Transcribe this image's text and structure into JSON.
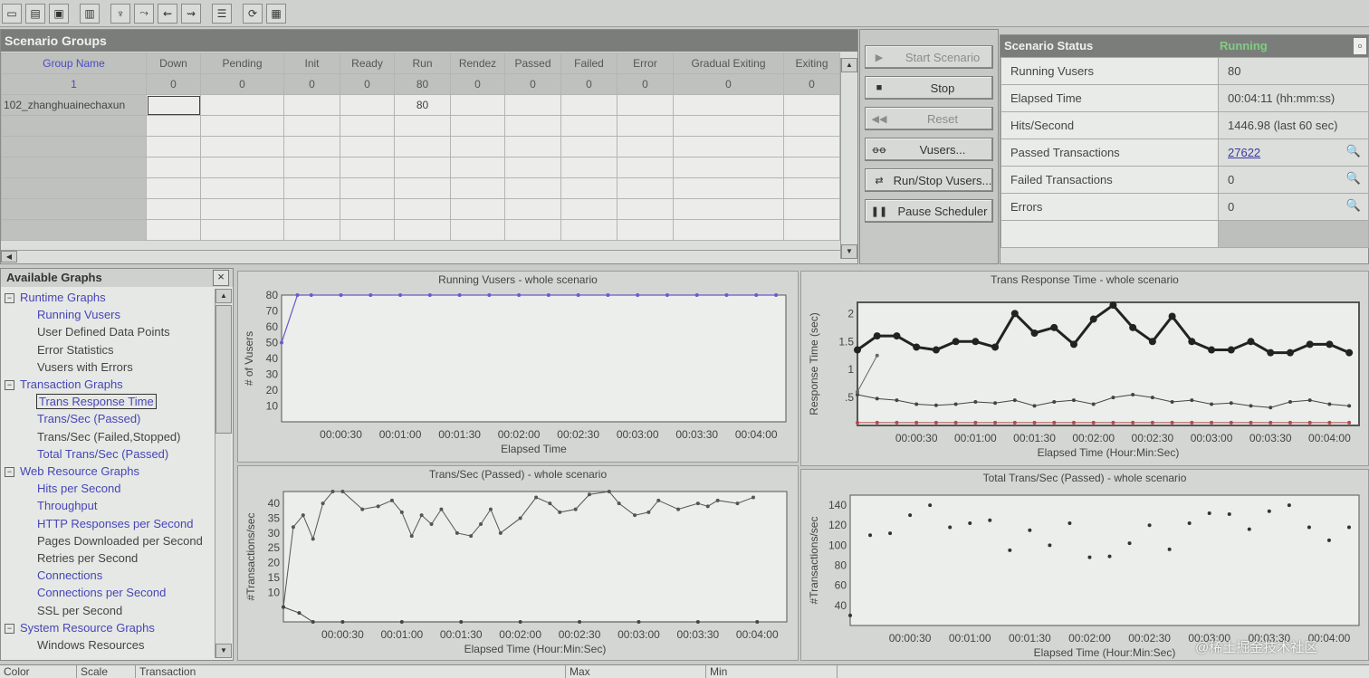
{
  "toolbar": {
    "icons": [
      "open-icon",
      "save-icon",
      "floppy-icon",
      "clipboard-icon",
      "host-icon",
      "step-icon",
      "step-back-icon",
      "step-up-icon",
      "list-icon",
      "refresh-icon",
      "grid-icon"
    ]
  },
  "scenario_groups": {
    "title": "Scenario Groups",
    "columns": [
      {
        "label": "Group Name",
        "count": "1"
      },
      {
        "label": "Down",
        "count": "0"
      },
      {
        "label": "Pending",
        "count": "0"
      },
      {
        "label": "Init",
        "count": "0"
      },
      {
        "label": "Ready",
        "count": "0"
      },
      {
        "label": "Run",
        "count": "80"
      },
      {
        "label": "Rendez",
        "count": "0"
      },
      {
        "label": "Passed",
        "count": "0"
      },
      {
        "label": "Failed",
        "count": "0"
      },
      {
        "label": "Error",
        "count": "0"
      },
      {
        "label": "Gradual Exiting",
        "count": "0"
      },
      {
        "label": "Exiting",
        "count": "0"
      }
    ],
    "rows": [
      {
        "group_name": "102_zhanghuainechaxun",
        "run": "80"
      }
    ]
  },
  "buttons": {
    "start": "Start Scenario",
    "stop": "Stop",
    "reset": "Reset",
    "vusers": "Vusers...",
    "run_stop": "Run/Stop Vusers...",
    "pause": "Pause Scheduler"
  },
  "scenario_status": {
    "title": "Scenario Status",
    "state": "Running",
    "rows": [
      {
        "label": "Running Vusers",
        "value": "80"
      },
      {
        "label": "Elapsed Time",
        "value": "00:04:11 (hh:mm:ss)"
      },
      {
        "label": "Hits/Second",
        "value": "1446.98 (last 60 sec)"
      },
      {
        "label": "Passed Transactions",
        "value": "27622"
      },
      {
        "label": "Failed Transactions",
        "value": "0"
      },
      {
        "label": "Errors",
        "value": "0"
      }
    ]
  },
  "available_graphs": {
    "title": "Available Graphs",
    "close": "×",
    "tree": [
      {
        "type": "cat",
        "label": "Runtime Graphs"
      },
      {
        "type": "link",
        "label": "Running Vusers"
      },
      {
        "type": "plain",
        "label": "User Defined Data Points"
      },
      {
        "type": "plain",
        "label": "Error Statistics"
      },
      {
        "type": "plain",
        "label": "Vusers with Errors"
      },
      {
        "type": "cat",
        "label": "Transaction Graphs"
      },
      {
        "type": "link",
        "label": "Trans Response Time"
      },
      {
        "type": "link",
        "label": "Trans/Sec (Passed)"
      },
      {
        "type": "plain",
        "label": "Trans/Sec (Failed,Stopped)"
      },
      {
        "type": "link",
        "label": "Total Trans/Sec (Passed)"
      },
      {
        "type": "cat",
        "label": "Web Resource Graphs"
      },
      {
        "type": "link",
        "label": "Hits per Second"
      },
      {
        "type": "link",
        "label": "Throughput"
      },
      {
        "type": "link",
        "label": "HTTP Responses per Second"
      },
      {
        "type": "plain",
        "label": "Pages Downloaded per Second"
      },
      {
        "type": "plain",
        "label": "Retries per Second"
      },
      {
        "type": "link",
        "label": "Connections"
      },
      {
        "type": "link",
        "label": "Connections per Second"
      },
      {
        "type": "plain",
        "label": "SSL per Second"
      },
      {
        "type": "cat",
        "label": "System Resource Graphs"
      },
      {
        "type": "plain",
        "label": "Windows Resources"
      }
    ]
  },
  "graphs": {
    "running_vusers": {
      "title": "Running Vusers - whole scenario",
      "ylabel": "# of Vusers",
      "xlabel": "Elapsed Time",
      "yticks": [
        "80",
        "70",
        "60",
        "50",
        "40",
        "30",
        "20",
        "10"
      ],
      "xticks": [
        "00:00:30",
        "00:01:00",
        "00:01:30",
        "00:02:00",
        "00:02:30",
        "00:03:00",
        "00:03:30",
        "00:04:00"
      ]
    },
    "trans_response_time": {
      "title": "Trans Response Time - whole scenario",
      "ylabel": "Response Time (sec)",
      "xlabel": "Elapsed Time (Hour:Min:Sec)",
      "yticks": [
        "2",
        "1.5",
        "1",
        ".5"
      ],
      "xticks": [
        "00:00:30",
        "00:01:00",
        "00:01:30",
        "00:02:00",
        "00:02:30",
        "00:03:00",
        "00:03:30",
        "00:04:00"
      ]
    },
    "trans_sec_passed": {
      "title": "Trans/Sec (Passed) - whole scenario",
      "ylabel": "#Transactions/sec",
      "xlabel": "Elapsed Time (Hour:Min:Sec)",
      "yticks": [
        "40",
        "35",
        "30",
        "25",
        "20",
        "15",
        "10"
      ],
      "xticks": [
        "00:00:30",
        "00:01:00",
        "00:01:30",
        "00:02:00",
        "00:02:30",
        "00:03:00",
        "00:03:30",
        "00:04:00"
      ]
    },
    "total_trans_sec": {
      "title": "Total Trans/Sec (Passed) - whole scenario",
      "ylabel": "#Transactions/sec",
      "xlabel": "Elapsed Time (Hour:Min:Sec)",
      "yticks": [
        "140",
        "120",
        "100",
        "80",
        "60",
        "40"
      ],
      "xticks": [
        "00:00:30",
        "00:01:00",
        "00:01:30",
        "00:02:00",
        "00:02:30",
        "00:03:00",
        "00:03:30",
        "00:04:00"
      ]
    }
  },
  "chart_data": [
    {
      "type": "line",
      "title": "Running Vusers - whole scenario",
      "xlabel": "Elapsed Time",
      "ylabel": "# of Vusers",
      "ylim": [
        0,
        80
      ],
      "xlim": [
        0,
        255
      ],
      "series": [
        {
          "x": [
            0,
            8,
            15,
            30,
            45,
            60,
            75,
            90,
            105,
            120,
            135,
            150,
            165,
            180,
            195,
            210,
            225,
            240,
            250
          ],
          "y": [
            50,
            80,
            80,
            80,
            80,
            80,
            80,
            80,
            80,
            80,
            80,
            80,
            80,
            80,
            80,
            80,
            80,
            80,
            80
          ],
          "color": "#6a5acd"
        }
      ]
    },
    {
      "type": "line",
      "title": "Trans Response Time - whole scenario",
      "xlabel": "Elapsed Time (Hour:Min:Sec)",
      "ylabel": "Response Time (sec)",
      "ylim": [
        0,
        2.2
      ],
      "xlim": [
        0,
        255
      ],
      "series": [
        {
          "x": [
            0,
            10,
            20,
            30,
            40,
            50,
            60,
            70,
            80,
            90,
            100,
            110,
            120,
            130,
            140,
            150,
            160,
            170,
            180,
            190,
            200,
            210,
            220,
            230,
            240,
            250
          ],
          "y": [
            1.35,
            1.6,
            1.6,
            1.4,
            1.35,
            1.5,
            1.5,
            1.4,
            2.0,
            1.65,
            1.75,
            1.45,
            1.9,
            2.15,
            1.75,
            1.5,
            1.95,
            1.5,
            1.35,
            1.35,
            1.5,
            1.3,
            1.3,
            1.45,
            1.45,
            1.3
          ],
          "color": "#222",
          "width": 3
        },
        {
          "x": [
            0,
            10,
            20,
            30,
            40,
            50,
            60,
            70,
            80,
            90,
            100,
            110,
            120,
            130,
            140,
            150,
            160,
            170,
            180,
            190,
            200,
            210,
            220,
            230,
            240,
            250
          ],
          "y": [
            0.55,
            0.48,
            0.45,
            0.38,
            0.36,
            0.38,
            0.42,
            0.4,
            0.45,
            0.35,
            0.42,
            0.45,
            0.38,
            0.5,
            0.55,
            0.5,
            0.42,
            0.45,
            0.38,
            0.4,
            0.35,
            0.32,
            0.42,
            0.45,
            0.38,
            0.35
          ],
          "color": "#444",
          "width": 1
        },
        {
          "x": [
            0,
            10,
            20,
            30,
            40,
            50,
            60,
            70,
            80,
            90,
            100,
            110,
            120,
            130,
            140,
            150,
            160,
            170,
            180,
            190,
            200,
            210,
            220,
            230,
            240,
            250
          ],
          "y": [
            0.05,
            0.05,
            0.05,
            0.05,
            0.05,
            0.05,
            0.05,
            0.05,
            0.05,
            0.05,
            0.05,
            0.05,
            0.05,
            0.05,
            0.05,
            0.05,
            0.05,
            0.05,
            0.05,
            0.05,
            0.05,
            0.05,
            0.05,
            0.05,
            0.05,
            0.05
          ],
          "color": "#b04a4a",
          "width": 1
        },
        {
          "x": [
            0,
            10
          ],
          "y": [
            0.6,
            1.25
          ],
          "color": "#666",
          "width": 1
        }
      ]
    },
    {
      "type": "line",
      "title": "Trans/Sec (Passed) - whole scenario",
      "xlabel": "Elapsed Time (Hour:Min:Sec)",
      "ylabel": "#Transactions/sec",
      "ylim": [
        0,
        44
      ],
      "xlim": [
        0,
        255
      ],
      "series": [
        {
          "x": [
            0,
            5,
            10,
            15,
            20,
            25,
            30,
            40,
            48,
            55,
            60,
            65,
            70,
            75,
            80,
            88,
            95,
            100,
            105,
            110,
            120,
            128,
            135,
            140,
            148,
            155,
            165,
            170,
            178,
            185,
            190,
            200,
            210,
            215,
            220,
            230,
            238
          ],
          "y": [
            5,
            32,
            36,
            28,
            40,
            44,
            44,
            38,
            39,
            41,
            37,
            29,
            36,
            33,
            38,
            30,
            29,
            33,
            38,
            30,
            35,
            42,
            40,
            37,
            38,
            43,
            44,
            40,
            36,
            37,
            41,
            38,
            40,
            39,
            41,
            40,
            42
          ],
          "color": "#555",
          "width": 1
        },
        {
          "x": [
            0,
            8,
            15,
            30,
            60,
            90,
            120,
            150,
            180,
            210,
            240
          ],
          "y": [
            5,
            3,
            0,
            0,
            0,
            0,
            0,
            0,
            0,
            0,
            0
          ],
          "color": "#444",
          "width": 1
        }
      ]
    },
    {
      "type": "scatter",
      "title": "Total Trans/Sec (Passed) - whole scenario",
      "xlabel": "Elapsed Time (Hour:Min:Sec)",
      "ylabel": "#Transactions/sec",
      "ylim": [
        20,
        150
      ],
      "xlim": [
        0,
        255
      ],
      "series": [
        {
          "x": [
            0,
            10,
            20,
            30,
            40,
            50,
            60,
            70,
            80,
            90,
            100,
            110,
            120,
            130,
            140,
            150,
            160,
            170,
            180,
            190,
            200,
            210,
            220,
            230,
            240,
            250
          ],
          "y": [
            30,
            110,
            112,
            130,
            140,
            118,
            122,
            125,
            95,
            115,
            100,
            122,
            88,
            89,
            102,
            120,
            96,
            122,
            132,
            131,
            116,
            134,
            140,
            118,
            105,
            118
          ],
          "color": "#333"
        }
      ]
    }
  ],
  "bottom_bar": [
    "Color",
    "Scale",
    "Transaction",
    "Max",
    "Min"
  ],
  "watermark": "@稀土掘金技术社区"
}
